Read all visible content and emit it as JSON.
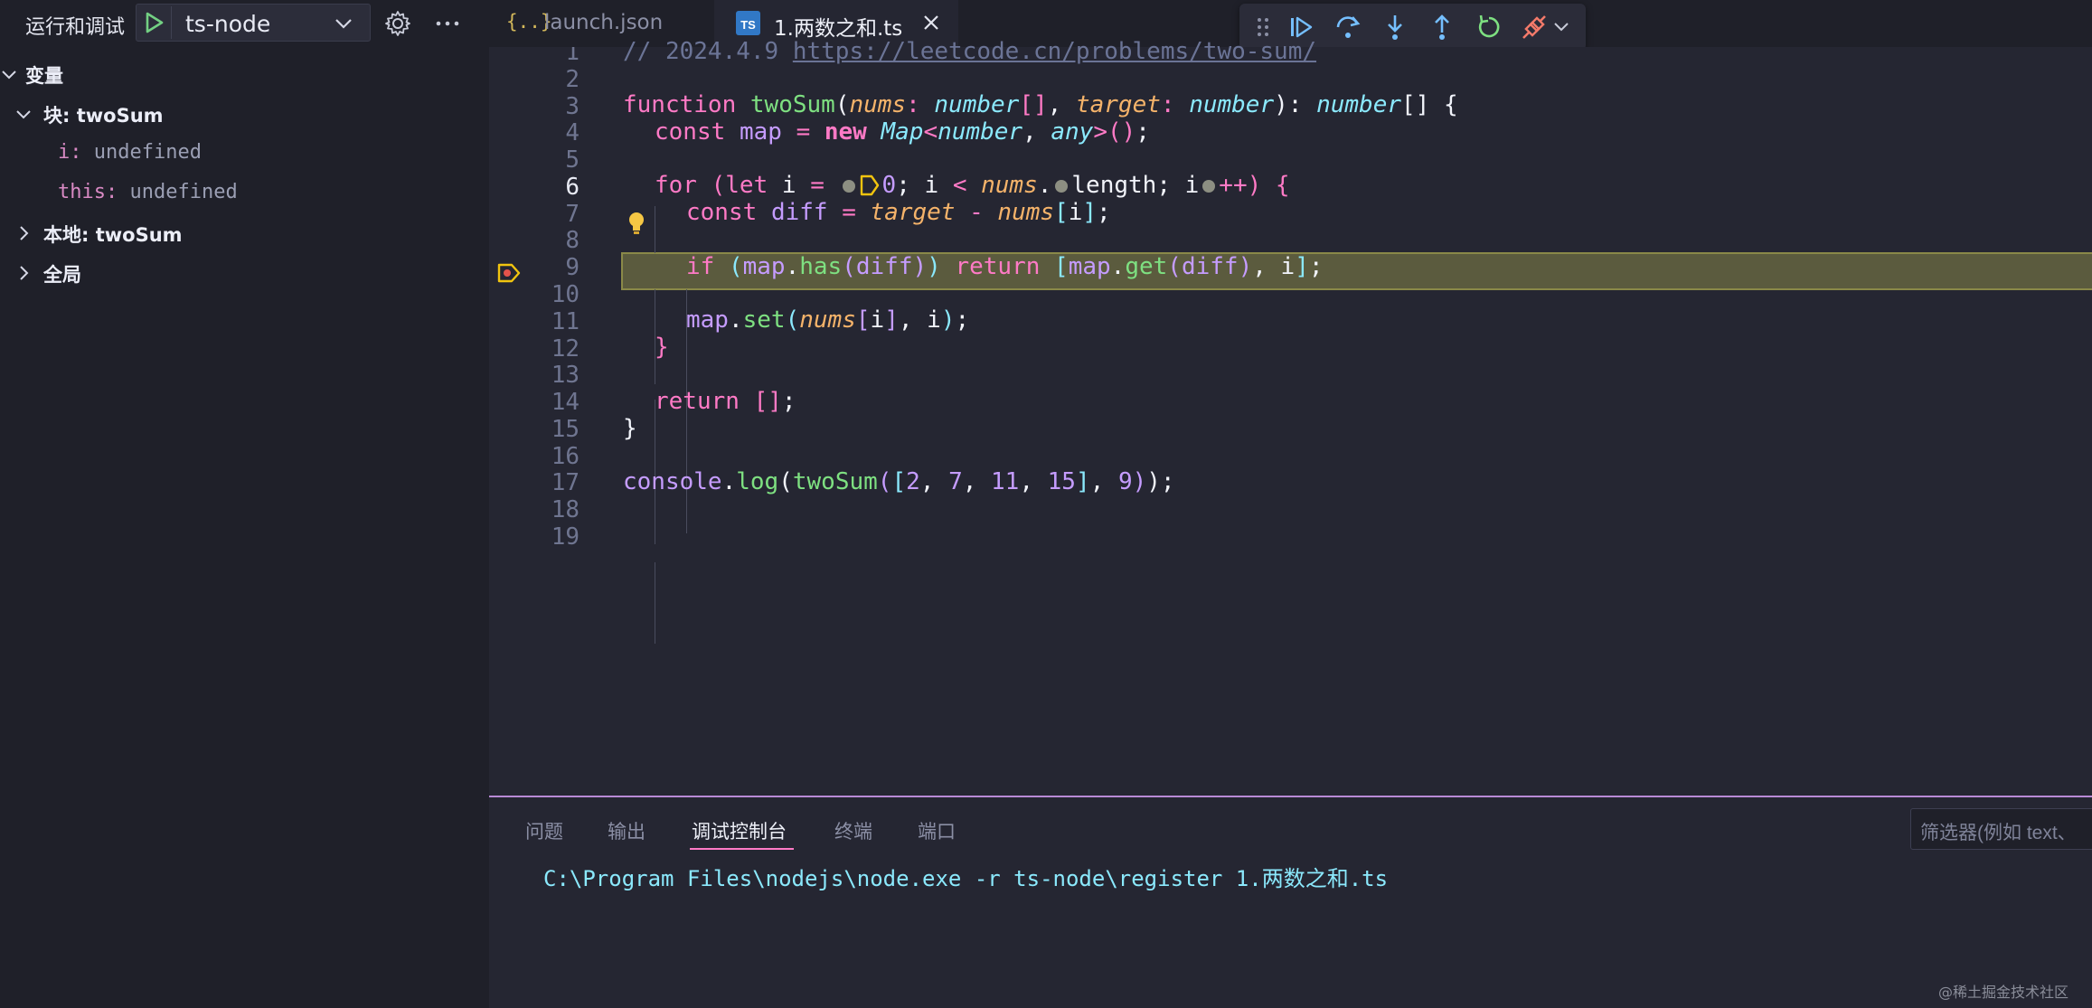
{
  "topbar": {
    "title": "运行和调试",
    "config_name": "ts-node",
    "icons": [
      "play-icon",
      "chevron-down-icon",
      "gear-icon",
      "more-icon"
    ]
  },
  "tabs": [
    {
      "label": "launch.json",
      "icon": "{..}",
      "active": false
    },
    {
      "label": "1.两数之和.ts",
      "icon": "TS",
      "active": true
    }
  ],
  "debug_toolbar": {
    "icons": [
      "drag-handle-icon",
      "continue-icon",
      "step-over-icon",
      "step-into-icon",
      "step-out-icon",
      "restart-icon",
      "disconnect-icon",
      "chevron-down-icon"
    ]
  },
  "sidebar": {
    "section": "变量",
    "scopes": [
      {
        "label": "块: twoSum",
        "expanded": true,
        "vars": [
          {
            "key": "i:",
            "value": "undefined"
          },
          {
            "key": "this:",
            "value": "undefined"
          }
        ]
      },
      {
        "label": "本地: twoSum",
        "expanded": false
      },
      {
        "label": "全局",
        "expanded": false
      }
    ]
  },
  "editor": {
    "line_numbers": [
      "1",
      "2",
      "3",
      "4",
      "5",
      "6",
      "7",
      "8",
      "9",
      "10",
      "11",
      "12",
      "13",
      "14",
      "15",
      "16",
      "17",
      "18",
      "19"
    ],
    "current_line": "6",
    "comment_date": "// 2024.4.9 ",
    "comment_url": "https://leetcode.cn/problems/two-sum/",
    "function_kw": "function",
    "function_name": "twoSum",
    "param_nums": "nums",
    "param_target": "target",
    "type_number": "number",
    "type_any": "any",
    "map_type": "Map",
    "kw_const": "const",
    "kw_new": "new",
    "kw_for": "for",
    "kw_let": "let",
    "kw_if": "if",
    "kw_return": "return",
    "var_map": "map",
    "var_i": "i",
    "var_diff": "diff",
    "prop_length": "length",
    "method_has": "has",
    "method_get": "get",
    "method_set": "set",
    "method_log": "log",
    "obj_console": "console",
    "zero": "0",
    "call_args": [
      "2",
      "7",
      "11",
      "15"
    ],
    "call_target": "9"
  },
  "panel": {
    "tabs": [
      "问题",
      "输出",
      "调试控制台",
      "终端",
      "端口"
    ],
    "active_tab": "调试控制台",
    "filter_placeholder": "筛选器(例如 text、",
    "console_output": "C:\\Program Files\\nodejs\\node.exe -r ts-node\\register 1.两数之和.ts"
  },
  "watermark": "@稀土掘金技术社区",
  "colors": {
    "accent": "#ff7ac6",
    "current_line": "#5b5b3e",
    "breakpoint": "#f1c40f"
  }
}
